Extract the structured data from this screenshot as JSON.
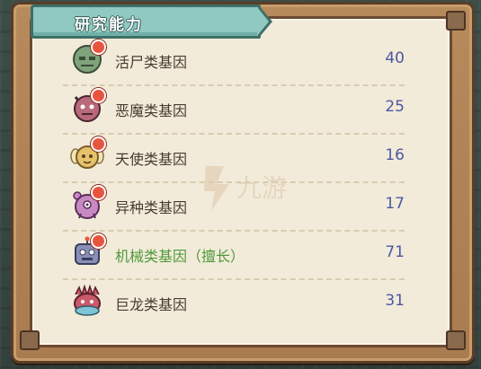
{
  "panel": {
    "title": "研究能力"
  },
  "genes": [
    {
      "label": "活尸类基因",
      "value": "40",
      "icon": "zombie-gene-icon",
      "color": "#7fa37a"
    },
    {
      "label": "恶魔类基因",
      "value": "25",
      "icon": "demon-gene-icon",
      "color": "#b86a7a"
    },
    {
      "label": "天使类基因",
      "value": "16",
      "icon": "angel-gene-icon",
      "color": "#e6c36b"
    },
    {
      "label": "异种类基因",
      "value": "17",
      "icon": "alien-gene-icon",
      "color": "#c889c2"
    },
    {
      "label": "机械类基因（擅长）",
      "value": "71",
      "icon": "mech-gene-icon",
      "color": "#8a8fb8",
      "highlighted": true
    },
    {
      "label": "巨龙类基因",
      "value": "31",
      "icon": "dragon-gene-icon",
      "color": "#c85a6a"
    }
  ],
  "watermark": {
    "text": "九游"
  },
  "colors": {
    "value_text": "#4c58a4",
    "highlight_text": "#4f9a3c",
    "ribbon": "#8fc9c2",
    "panel_bg": "#f2ebd9"
  }
}
